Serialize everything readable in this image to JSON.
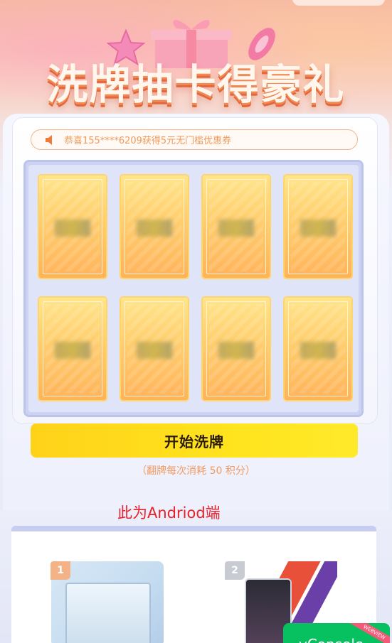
{
  "hero": {
    "title": "洗牌抽卡得豪礼"
  },
  "ticker": {
    "icon": "speaker-icon",
    "text": "恭喜155****6209获得5元无门槛优惠券"
  },
  "cards": {
    "count": 8
  },
  "actions": {
    "start_label": "开始洗牌",
    "cost_note": "（翻牌每次消耗 50 积分）"
  },
  "annotation": {
    "text": "此为Andriod端"
  },
  "prizes": [
    {
      "rank": "1"
    },
    {
      "rank": "2"
    }
  ],
  "vconsole": {
    "label": "vConsole",
    "tag": "WEBVIEW"
  },
  "colors": {
    "button": "#ffe01d",
    "accent": "#f09a5a",
    "annotation": "#e8202a"
  }
}
